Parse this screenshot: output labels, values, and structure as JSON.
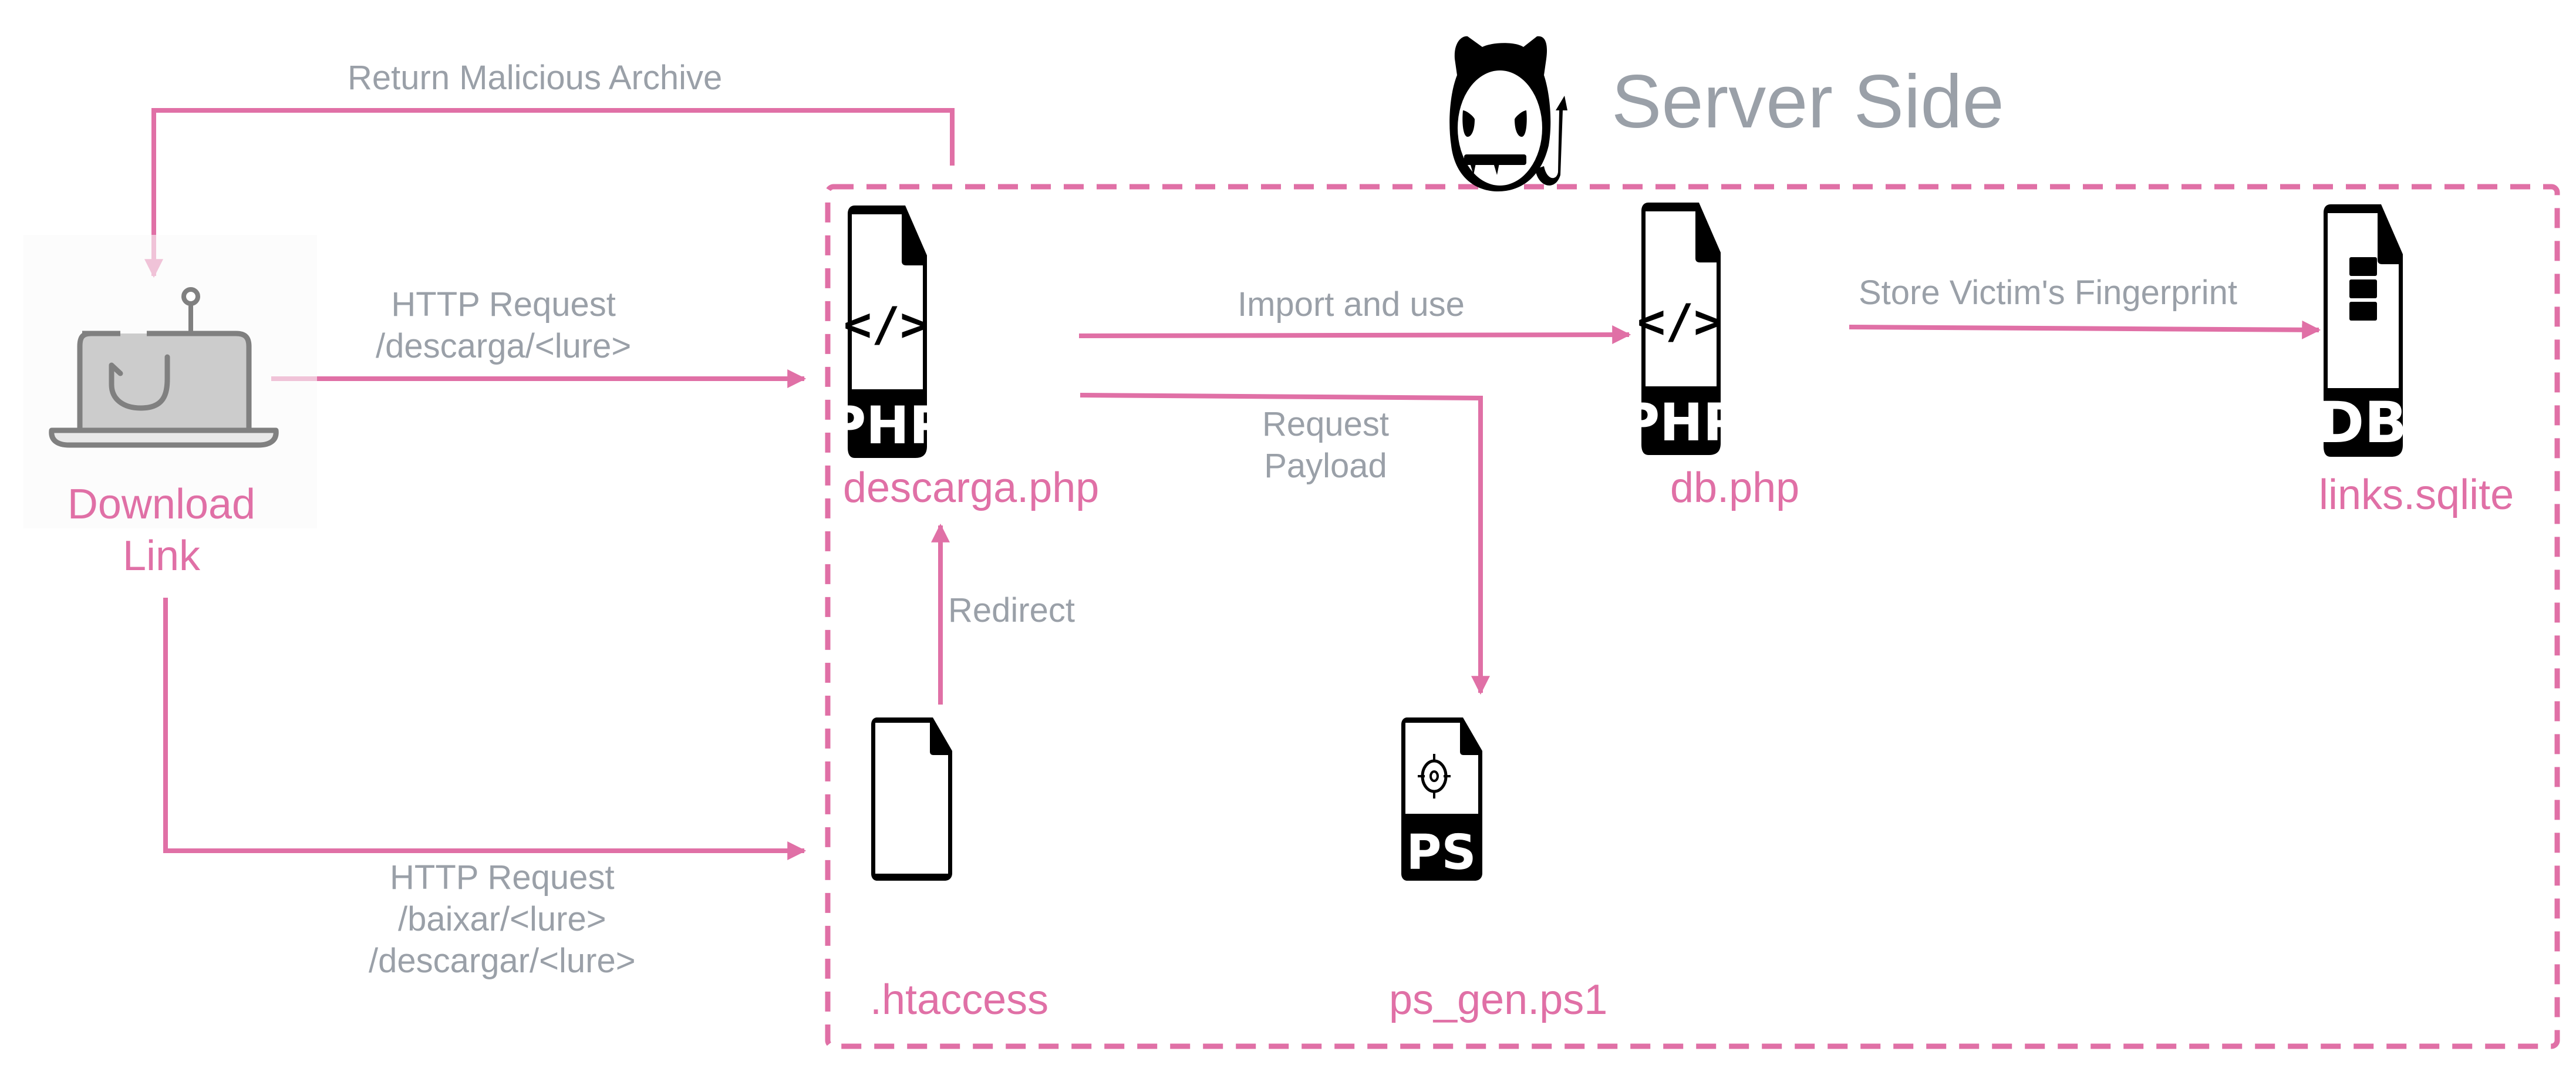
{
  "title": "Server Side",
  "title_icon": "devil-icon",
  "colors": {
    "accent": "#e070a6",
    "label_gray": "#9aa0a8",
    "icon_black": "#000000",
    "laptop_gray": "#808080"
  },
  "client": {
    "label_line1": "Download",
    "label_line2": "Link",
    "icon": "phishing-laptop-icon"
  },
  "server_nodes": [
    {
      "id": "descarga",
      "label": "descarga.php",
      "icon": "php-file-icon",
      "badge": "PHP",
      "glyph": "</>"
    },
    {
      "id": "db",
      "label": "db.php",
      "icon": "php-file-icon",
      "badge": "PHP",
      "glyph": "</>"
    },
    {
      "id": "sqlite",
      "label": "links.sqlite",
      "icon": "database-file-icon",
      "badge": "DB"
    },
    {
      "id": "htaccess",
      "label": ".htaccess",
      "icon": "blank-file-icon"
    },
    {
      "id": "psgen",
      "label": "ps_gen.ps1",
      "icon": "powershell-file-icon",
      "badge": "PS"
    }
  ],
  "edges": {
    "return_archive": "Return Malicious Archive",
    "http1_line1": "HTTP Request",
    "http1_line2": "/descarga/<lure>",
    "http2_line1": "HTTP Request",
    "http2_line2": "/baixar/<lure>",
    "http2_line3": "/descargar/<lure>",
    "import_use": "Import and use",
    "request_payload_line1": "Request",
    "request_payload_line2": "Payload",
    "store_fingerprint": "Store Victim's Fingerprint",
    "redirect": "Redirect"
  }
}
